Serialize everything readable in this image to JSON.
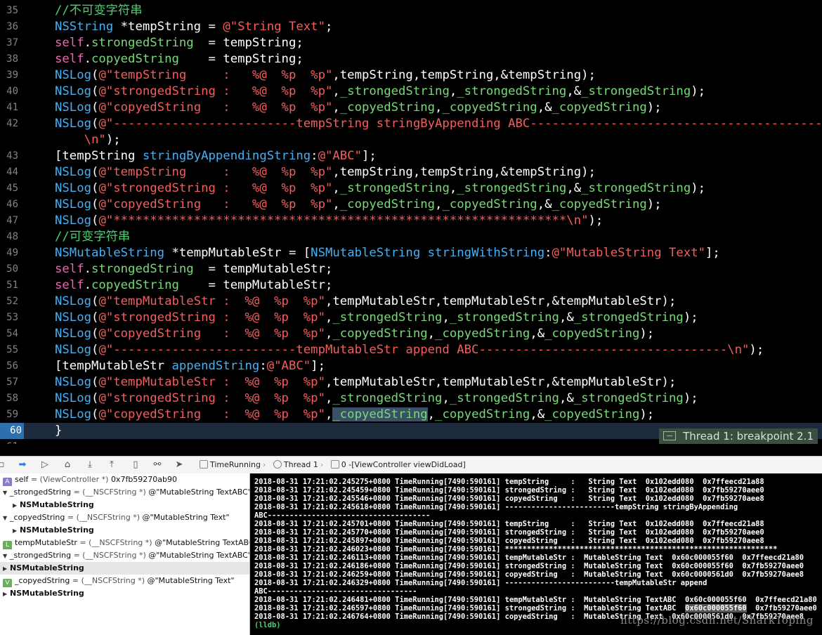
{
  "editor": {
    "lines": [
      {
        "n": "35",
        "segs": [
          [
            "cmt",
            "//不可变字符串"
          ]
        ]
      },
      {
        "n": "36",
        "segs": [
          [
            "type",
            "NSString"
          ],
          [
            "id",
            " *tempString = "
          ],
          [
            "str",
            "@\"String Text\""
          ],
          [
            "id",
            ";"
          ]
        ]
      },
      {
        "n": "37",
        "segs": [
          [
            "kw",
            "self"
          ],
          [
            "id",
            "."
          ],
          [
            "prop",
            "strongedString"
          ],
          [
            "id",
            "  = tempString;"
          ]
        ]
      },
      {
        "n": "38",
        "segs": [
          [
            "kw",
            "self"
          ],
          [
            "id",
            "."
          ],
          [
            "prop",
            "copyedString"
          ],
          [
            "id",
            "    = tempString;"
          ]
        ]
      },
      {
        "n": "39",
        "segs": [
          [
            "type",
            "NSLog"
          ],
          [
            "id",
            "("
          ],
          [
            "str",
            "@\"tempString     :   %@  %p  %p\""
          ],
          [
            "id",
            ",tempString,tempString,&tempString);"
          ]
        ]
      },
      {
        "n": "40",
        "segs": [
          [
            "type",
            "NSLog"
          ],
          [
            "id",
            "("
          ],
          [
            "str",
            "@\"strongedString :   %@  %p  %p\""
          ],
          [
            "id",
            ","
          ],
          [
            "prop",
            "_strongedString"
          ],
          [
            "id",
            ","
          ],
          [
            "prop",
            "_strongedString"
          ],
          [
            "id",
            ",&"
          ],
          [
            "prop",
            "_strongedString"
          ],
          [
            "id",
            ");"
          ]
        ]
      },
      {
        "n": "41",
        "segs": [
          [
            "type",
            "NSLog"
          ],
          [
            "id",
            "("
          ],
          [
            "str",
            "@\"copyedString   :   %@  %p  %p\""
          ],
          [
            "id",
            ","
          ],
          [
            "prop",
            "_copyedString"
          ],
          [
            "id",
            ","
          ],
          [
            "prop",
            "_copyedString"
          ],
          [
            "id",
            ",&"
          ],
          [
            "prop",
            "_copyedString"
          ],
          [
            "id",
            ");"
          ]
        ]
      },
      {
        "n": "42",
        "segs": [
          [
            "type",
            "NSLog"
          ],
          [
            "id",
            "("
          ],
          [
            "str",
            "@\"-------------------------tempString stringByAppending ABC-----------------------------------------------"
          ]
        ]
      },
      {
        "n": "",
        "segs": [
          [
            "str",
            "    \\n\""
          ],
          [
            "id",
            ");"
          ]
        ]
      },
      {
        "n": "43",
        "segs": [
          [
            "id",
            "[tempString "
          ],
          [
            "sel",
            "stringByAppendingString"
          ],
          [
            "id",
            ":"
          ],
          [
            "str",
            "@\"ABC\""
          ],
          [
            "id",
            "];"
          ]
        ]
      },
      {
        "n": "44",
        "segs": [
          [
            "type",
            "NSLog"
          ],
          [
            "id",
            "("
          ],
          [
            "str",
            "@\"tempString     :   %@  %p  %p\""
          ],
          [
            "id",
            ",tempString,tempString,&tempString);"
          ]
        ]
      },
      {
        "n": "45",
        "segs": [
          [
            "type",
            "NSLog"
          ],
          [
            "id",
            "("
          ],
          [
            "str",
            "@\"strongedString :   %@  %p  %p\""
          ],
          [
            "id",
            ","
          ],
          [
            "prop",
            "_strongedString"
          ],
          [
            "id",
            ","
          ],
          [
            "prop",
            "_strongedString"
          ],
          [
            "id",
            ",&"
          ],
          [
            "prop",
            "_strongedString"
          ],
          [
            "id",
            ");"
          ]
        ]
      },
      {
        "n": "46",
        "segs": [
          [
            "type",
            "NSLog"
          ],
          [
            "id",
            "("
          ],
          [
            "str",
            "@\"copyedString   :   %@  %p  %p\""
          ],
          [
            "id",
            ","
          ],
          [
            "prop",
            "_copyedString"
          ],
          [
            "id",
            ","
          ],
          [
            "prop",
            "_copyedString"
          ],
          [
            "id",
            ",&"
          ],
          [
            "prop",
            "_copyedString"
          ],
          [
            "id",
            ");"
          ]
        ]
      },
      {
        "n": "47",
        "segs": [
          [
            "type",
            "NSLog"
          ],
          [
            "id",
            "("
          ],
          [
            "str",
            "@\"**************************************************************\\n\""
          ],
          [
            "id",
            ");"
          ]
        ]
      },
      {
        "n": "48",
        "segs": [
          [
            "cmt",
            "//可变字符串"
          ]
        ]
      },
      {
        "n": "49",
        "segs": [
          [
            "type",
            "NSMutableString"
          ],
          [
            "id",
            " *tempMutableStr = ["
          ],
          [
            "type",
            "NSMutableString"
          ],
          [
            "id",
            " "
          ],
          [
            "sel",
            "stringWithString"
          ],
          [
            "id",
            ":"
          ],
          [
            "str",
            "@\"MutableString Text\""
          ],
          [
            "id",
            "];"
          ]
        ]
      },
      {
        "n": "50",
        "segs": [
          [
            "kw",
            "self"
          ],
          [
            "id",
            "."
          ],
          [
            "prop",
            "strongedString"
          ],
          [
            "id",
            "  = tempMutableStr;"
          ]
        ]
      },
      {
        "n": "51",
        "segs": [
          [
            "kw",
            "self"
          ],
          [
            "id",
            "."
          ],
          [
            "prop",
            "copyedString"
          ],
          [
            "id",
            "    = tempMutableStr;"
          ]
        ]
      },
      {
        "n": "52",
        "segs": [
          [
            "type",
            "NSLog"
          ],
          [
            "id",
            "("
          ],
          [
            "str",
            "@\"tempMutableStr :  %@  %p  %p\""
          ],
          [
            "id",
            ",tempMutableStr,tempMutableStr,&tempMutableStr);"
          ]
        ]
      },
      {
        "n": "53",
        "segs": [
          [
            "type",
            "NSLog"
          ],
          [
            "id",
            "("
          ],
          [
            "str",
            "@\"strongedString :  %@  %p  %p\""
          ],
          [
            "id",
            ","
          ],
          [
            "prop",
            "_strongedString"
          ],
          [
            "id",
            ","
          ],
          [
            "prop",
            "_strongedString"
          ],
          [
            "id",
            ",&"
          ],
          [
            "prop",
            "_strongedString"
          ],
          [
            "id",
            ");"
          ]
        ]
      },
      {
        "n": "54",
        "segs": [
          [
            "type",
            "NSLog"
          ],
          [
            "id",
            "("
          ],
          [
            "str",
            "@\"copyedString   :  %@  %p  %p\""
          ],
          [
            "id",
            ","
          ],
          [
            "prop",
            "_copyedString"
          ],
          [
            "id",
            ","
          ],
          [
            "prop",
            "_copyedString"
          ],
          [
            "id",
            ",&"
          ],
          [
            "prop",
            "_copyedString"
          ],
          [
            "id",
            ");"
          ]
        ]
      },
      {
        "n": "55",
        "segs": [
          [
            "type",
            "NSLog"
          ],
          [
            "id",
            "("
          ],
          [
            "str",
            "@\"-------------------------tempMutableStr append ABC----------------------------------\\n\""
          ],
          [
            "id",
            ");"
          ]
        ]
      },
      {
        "n": "56",
        "segs": [
          [
            "id",
            "[tempMutableStr "
          ],
          [
            "sel",
            "appendString"
          ],
          [
            "id",
            ":"
          ],
          [
            "str",
            "@\"ABC\""
          ],
          [
            "id",
            "];"
          ]
        ]
      },
      {
        "n": "57",
        "segs": [
          [
            "type",
            "NSLog"
          ],
          [
            "id",
            "("
          ],
          [
            "str",
            "@\"tempMutableStr :  %@  %p  %p\""
          ],
          [
            "id",
            ",tempMutableStr,tempMutableStr,&tempMutableStr);"
          ]
        ]
      },
      {
        "n": "58",
        "segs": [
          [
            "type",
            "NSLog"
          ],
          [
            "id",
            "("
          ],
          [
            "str",
            "@\"strongedString :  %@  %p  %p\""
          ],
          [
            "id",
            ","
          ],
          [
            "prop",
            "_strongedString"
          ],
          [
            "id",
            ","
          ],
          [
            "prop",
            "_strongedString"
          ],
          [
            "id",
            ",&"
          ],
          [
            "prop",
            "_strongedString"
          ],
          [
            "id",
            ");"
          ]
        ]
      },
      {
        "n": "59",
        "segs": [
          [
            "type",
            "NSLog"
          ],
          [
            "id",
            "("
          ],
          [
            "str",
            "@\"copyedString   :  %@  %p  %p\""
          ],
          [
            "id",
            ","
          ],
          [
            "hiprop",
            "_copyedString"
          ],
          [
            "id",
            ","
          ],
          [
            "prop",
            "_copyedString"
          ],
          [
            "id",
            ",&"
          ],
          [
            "prop",
            "_copyedString"
          ],
          [
            "id",
            ");"
          ]
        ]
      },
      {
        "n": "60",
        "segs": [
          [
            "id",
            "}"
          ]
        ],
        "current": true
      },
      {
        "n": "61",
        "segs": []
      }
    ],
    "breakpoint_label": "Thread 1: breakpoint 2.1"
  },
  "debugbar": {
    "crumbs": [
      "TimeRunning",
      "Thread 1",
      "0 -[ViewController viewDidLoad]"
    ]
  },
  "variables": [
    {
      "indent": 0,
      "badge": "A",
      "badge_kind": "a",
      "tri": "",
      "name": "self",
      "type": " = (ViewController *) ",
      "value": "0x7fb59270ab90"
    },
    {
      "indent": 0,
      "badge": "",
      "badge_kind": "",
      "tri": "▼",
      "name": "_strongedString",
      "type": " = (__NSCFString *) ",
      "value": "@\"MutableString TextABC\""
    },
    {
      "indent": 1,
      "badge": "",
      "badge_kind": "",
      "tri": "▶",
      "name": "NSMutableString",
      "type": "",
      "value": "",
      "bold": true
    },
    {
      "indent": 0,
      "badge": "",
      "badge_kind": "",
      "tri": "▼",
      "name": "_copyedString",
      "type": " = (__NSCFString *) ",
      "value": "@\"MutableString Text\""
    },
    {
      "indent": 1,
      "badge": "",
      "badge_kind": "",
      "tri": "▶",
      "name": "NSMutableString",
      "type": "",
      "value": "",
      "bold": true
    },
    {
      "indent": 0,
      "badge": "L",
      "badge_kind": "l",
      "tri": "",
      "name": "tempMutableStr",
      "type": " = (__NSCFString *) ",
      "value": "@\"MutableString TextABC\""
    },
    {
      "indent": 0,
      "badge": "",
      "badge_kind": "",
      "tri": "▼",
      "name": "_strongedString",
      "type": " = (__NSCFString *) ",
      "value": "@\"MutableString TextABC\""
    },
    {
      "indent": 0,
      "badge": "",
      "badge_kind": "",
      "tri": "▶",
      "name": "NSMutableString",
      "type": "",
      "value": "",
      "bold": true,
      "selected": true
    },
    {
      "indent": 0,
      "badge": "V",
      "badge_kind": "v",
      "tri": "",
      "name": "_copyedString",
      "type": " = (__NSCFString *) ",
      "value": "@\"MutableString Text\""
    },
    {
      "indent": 0,
      "badge": "",
      "badge_kind": "",
      "tri": "▶",
      "name": "NSMutableString",
      "type": "",
      "value": "",
      "bold": true
    }
  ],
  "console": {
    "lines": [
      "2018-08-31 17:21:02.245275+0800 TimeRunning[7490:590161] tempString     :   String Text  0x102edd080  0x7ffeecd21a88",
      "2018-08-31 17:21:02.245459+0800 TimeRunning[7490:590161] strongedString :   String Text  0x102edd080  0x7fb59270aee0",
      "2018-08-31 17:21:02.245546+0800 TimeRunning[7490:590161] copyedString   :   String Text  0x102edd080  0x7fb59270aee8",
      "2018-08-31 17:21:02.245618+0800 TimeRunning[7490:590161] -------------------------tempString stringByAppending",
      "ABC-------------------------------------",
      "2018-08-31 17:21:02.245701+0800 TimeRunning[7490:590161] tempString     :   String Text  0x102edd080  0x7ffeecd21a88",
      "2018-08-31 17:21:02.245770+0800 TimeRunning[7490:590161] strongedString :   String Text  0x102edd080  0x7fb59270aee0",
      "2018-08-31 17:21:02.245897+0800 TimeRunning[7490:590161] copyedString   :   String Text  0x102edd080  0x7fb59270aee8",
      "2018-08-31 17:21:02.246023+0800 TimeRunning[7490:590161] **************************************************************",
      "2018-08-31 17:21:02.246113+0800 TimeRunning[7490:590161] tempMutableStr :  MutableString Text  0x60c000055f60  0x7ffeecd21a80",
      "2018-08-31 17:21:02.246186+0800 TimeRunning[7490:590161] strongedString :  MutableString Text  0x60c000055f60  0x7fb59270aee0",
      "2018-08-31 17:21:02.246259+0800 TimeRunning[7490:590161] copyedString   :  MutableString Text  0x60c0000561d0  0x7fb59270aee8",
      "2018-08-31 17:21:02.246329+0800 TimeRunning[7490:590161] -------------------------tempMutableStr append",
      "ABC----------------------------------",
      "2018-08-31 17:21:02.246481+0800 TimeRunning[7490:590161] tempMutableStr :  MutableString TextABC  0x60c000055f60  0x7ffeecd21a80",
      "2018-08-31 17:21:02.246597+0800 TimeRunning[7490:590161] strongedString :  MutableString TextABC  0x60c000055f60  0x7fb59270aee0",
      "2018-08-31 17:21:02.246764+0800 TimeRunning[7490:590161] copyedString   :  MutableString Text  0x60c0000561d0  0x7fb59270aee8"
    ],
    "highlight": {
      "line": 15,
      "text": "0x60c000055f60"
    },
    "prompt": "(lldb)",
    "watermark": "https://blog.csdn.net/SharkToping"
  }
}
